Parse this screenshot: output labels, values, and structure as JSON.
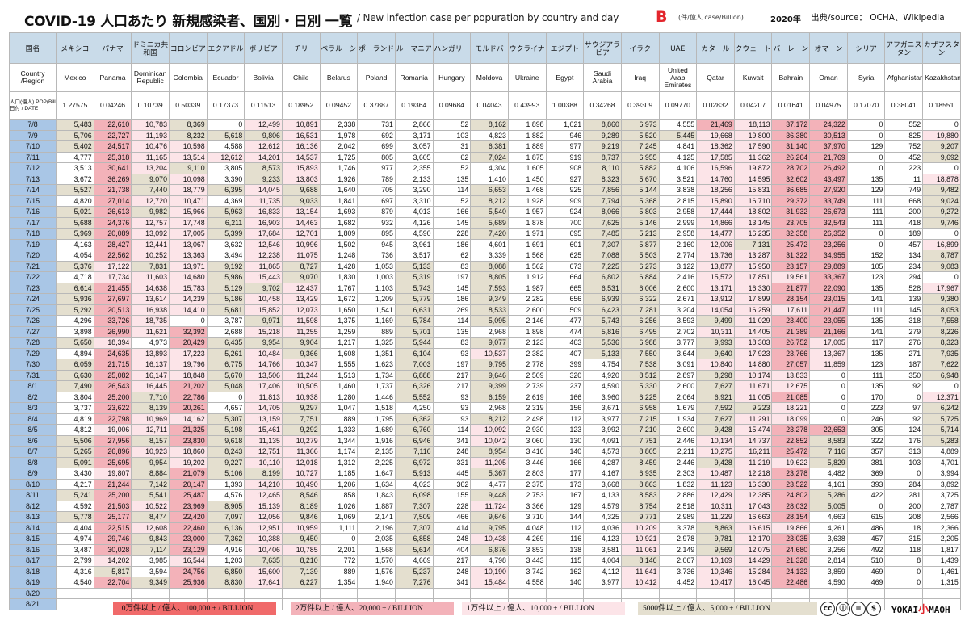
{
  "title": {
    "main": "COVID-19 人口あたり 新規感染者、国別・日別 一覧",
    "sub": "/ New infection case per popuration by country and day",
    "edition": "B",
    "unit": "(件/億人 case/Billion)",
    "year": "2020年",
    "source": "出典/source： OCHA、Wikipedia"
  },
  "headers": {
    "country_jp_label": "国名",
    "country_en_label": "Country /Region",
    "pop_label": "人口(億人) POP(Billion)",
    "date_label": "日付 / DATE",
    "jp": [
      "メキシコ",
      "パナマ",
      "ドミニカ共和国",
      "コロンビア",
      "エクアドル",
      "ボリビア",
      "チリ",
      "ベラルーシ",
      "ポーランド",
      "ルーマニア",
      "ハンガリー",
      "モルドバ",
      "ウクライナ",
      "エジプト",
      "サウジアラビア",
      "イラク",
      "UAE",
      "カタール",
      "クウェート",
      "バーレーン",
      "オマーン",
      "シリア",
      "アフガニスタン",
      "カザフスタン"
    ],
    "en": [
      "Mexico",
      "Panama",
      "Dominican Republic",
      "Colombia",
      "Ecuador",
      "Bolivia",
      "Chile",
      "Belarus",
      "Poland",
      "Romania",
      "Hungary",
      "Moldova",
      "Ukraine",
      "Egypt",
      "Saudi Arabia",
      "Iraq",
      "United Arab Emirates",
      "Qatar",
      "Kuwait",
      "Bahrain",
      "Oman",
      "Syria",
      "Afghanistan",
      "Kazakhstan"
    ],
    "pop": [
      "1.27575",
      "0.04246",
      "0.10739",
      "0.50339",
      "0.17373",
      "0.11513",
      "0.18952",
      "0.09452",
      "0.37887",
      "0.19364",
      "0.09684",
      "0.04043",
      "0.43993",
      "1.00388",
      "0.34268",
      "0.39309",
      "0.09770",
      "0.02832",
      "0.04207",
      "0.01641",
      "0.04975",
      "0.17070",
      "0.38041",
      "0.18551"
    ]
  },
  "rows": [
    [
      "7/8",
      "5,483",
      "22,610",
      "10,783",
      "8,369",
      "0",
      "12,499",
      "10,891",
      "2,338",
      "731",
      "2,866",
      "52",
      "8,162",
      "1,898",
      "1,021",
      "8,860",
      "6,973",
      "4,555",
      "21,469",
      "18,113",
      "37,172",
      "24,322",
      "0",
      "552",
      "0"
    ],
    [
      "7/9",
      "5,706",
      "22,727",
      "11,193",
      "8,232",
      "5,618",
      "9,806",
      "16,531",
      "1,978",
      "692",
      "3,171",
      "103",
      "4,823",
      "1,882",
      "946",
      "9,289",
      "5,520",
      "5,445",
      "19,668",
      "19,800",
      "36,380",
      "30,513",
      "0",
      "825",
      "19,880"
    ],
    [
      "7/10",
      "5,402",
      "24,517",
      "10,476",
      "10,598",
      "4,588",
      "12,612",
      "16,136",
      "2,042",
      "699",
      "3,057",
      "31",
      "6,381",
      "1,889",
      "977",
      "9,219",
      "7,245",
      "4,841",
      "18,362",
      "17,590",
      "31,140",
      "37,970",
      "129",
      "752",
      "9,207"
    ],
    [
      "7/11",
      "4,777",
      "25,318",
      "11,165",
      "13,514",
      "12,612",
      "14,201",
      "14,537",
      "1,725",
      "805",
      "3,605",
      "62",
      "7,024",
      "1,875",
      "919",
      "8,737",
      "6,955",
      "4,125",
      "17,585",
      "11,362",
      "26,264",
      "21,769",
      "0",
      "452",
      "9,692"
    ],
    [
      "7/12",
      "3,513",
      "30,641",
      "13,204",
      "9,110",
      "3,805",
      "8,573",
      "15,893",
      "1,746",
      "977",
      "2,355",
      "52",
      "4,304",
      "1,605",
      "908",
      "8,110",
      "5,882",
      "4,106",
      "16,596",
      "19,872",
      "28,702",
      "26,492",
      "0",
      "223",
      "0"
    ],
    [
      "7/13",
      "3,672",
      "36,269",
      "9,070",
      "10,098",
      "3,390",
      "9,233",
      "13,803",
      "1,926",
      "789",
      "2,133",
      "135",
      "1,410",
      "1,450",
      "927",
      "8,323",
      "5,670",
      "3,521",
      "14,760",
      "14,595",
      "32,602",
      "43,497",
      "135",
      "11",
      "18,878"
    ],
    [
      "7/14",
      "5,527",
      "21,738",
      "7,440",
      "18,779",
      "6,395",
      "14,045",
      "9,688",
      "1,640",
      "705",
      "3,290",
      "114",
      "6,653",
      "1,468",
      "925",
      "7,856",
      "5,144",
      "3,838",
      "18,256",
      "15,831",
      "36,685",
      "27,920",
      "129",
      "749",
      "9,482"
    ],
    [
      "7/15",
      "4,820",
      "27,014",
      "12,720",
      "10,471",
      "4,369",
      "11,735",
      "9,033",
      "1,841",
      "697",
      "3,310",
      "52",
      "8,212",
      "1,928",
      "909",
      "7,794",
      "5,368",
      "2,815",
      "15,890",
      "16,710",
      "29,372",
      "33,749",
      "111",
      "668",
      "9,024"
    ],
    [
      "7/16",
      "5,021",
      "26,613",
      "9,982",
      "15,966",
      "5,963",
      "16,833",
      "13,154",
      "1,693",
      "879",
      "4,013",
      "166",
      "5,540",
      "1,957",
      "924",
      "8,066",
      "5,803",
      "2,958",
      "17,444",
      "18,802",
      "31,932",
      "26,673",
      "111",
      "200",
      "9,272"
    ],
    [
      "7/17",
      "5,688",
      "24,376",
      "12,757",
      "17,748",
      "6,211",
      "16,903",
      "14,463",
      "1,682",
      "932",
      "4,126",
      "145",
      "5,689",
      "1,878",
      "700",
      "7,625",
      "5,146",
      "2,999",
      "14,866",
      "13,145",
      "23,705",
      "32,543",
      "111",
      "418",
      "9,746"
    ],
    [
      "7/18",
      "5,969",
      "20,089",
      "13,092",
      "17,005",
      "5,399",
      "17,684",
      "12,701",
      "1,809",
      "895",
      "4,590",
      "228",
      "7,420",
      "1,971",
      "695",
      "7,485",
      "5,213",
      "2,958",
      "14,477",
      "16,235",
      "32,358",
      "26,352",
      "0",
      "189",
      "0"
    ],
    [
      "7/19",
      "4,163",
      "28,427",
      "12,441",
      "13,067",
      "3,632",
      "12,546",
      "10,996",
      "1,502",
      "945",
      "3,961",
      "186",
      "4,601",
      "1,691",
      "601",
      "7,307",
      "5,877",
      "2,160",
      "12,006",
      "7,131",
      "25,472",
      "23,256",
      "0",
      "457",
      "16,899"
    ],
    [
      "7/20",
      "4,054",
      "22,562",
      "10,252",
      "13,363",
      "3,494",
      "12,238",
      "11,075",
      "1,248",
      "736",
      "3,517",
      "62",
      "3,339",
      "1,568",
      "625",
      "7,088",
      "5,503",
      "2,774",
      "13,736",
      "13,287",
      "31,322",
      "34,955",
      "152",
      "134",
      "8,787"
    ],
    [
      "7/21",
      "5,376",
      "17,122",
      "7,831",
      "13,971",
      "9,192",
      "11,865",
      "8,727",
      "1,428",
      "1,053",
      "5,133",
      "83",
      "8,088",
      "1,562",
      "673",
      "7,225",
      "6,273",
      "3,122",
      "13,877",
      "15,950",
      "23,157",
      "29,889",
      "105",
      "234",
      "9,083"
    ],
    [
      "7/22",
      "4,718",
      "17,734",
      "11,603",
      "14,680",
      "5,986",
      "15,443",
      "9,070",
      "1,830",
      "1,003",
      "5,319",
      "197",
      "8,805",
      "1,912",
      "664",
      "6,802",
      "6,884",
      "2,416",
      "15,572",
      "17,851",
      "19,561",
      "33,367",
      "123",
      "294",
      "0"
    ],
    [
      "7/23",
      "6,614",
      "21,455",
      "14,638",
      "15,783",
      "5,129",
      "9,702",
      "12,437",
      "1,767",
      "1,103",
      "5,743",
      "145",
      "7,593",
      "1,987",
      "665",
      "6,531",
      "6,006",
      "2,600",
      "13,171",
      "16,330",
      "21,877",
      "22,090",
      "135",
      "528",
      "17,967"
    ],
    [
      "7/24",
      "5,936",
      "27,697",
      "13,614",
      "14,239",
      "5,186",
      "10,458",
      "13,429",
      "1,672",
      "1,209",
      "5,779",
      "186",
      "9,349",
      "2,282",
      "656",
      "6,939",
      "6,322",
      "2,671",
      "13,912",
      "17,899",
      "28,154",
      "23,015",
      "141",
      "139",
      "9,380"
    ],
    [
      "7/25",
      "5,292",
      "20,513",
      "16,938",
      "14,410",
      "5,681",
      "15,852",
      "12,073",
      "1,650",
      "1,541",
      "6,631",
      "269",
      "8,533",
      "2,600",
      "509",
      "6,423",
      "7,281",
      "3,204",
      "14,054",
      "16,259",
      "17,611",
      "21,447",
      "111",
      "145",
      "8,053"
    ],
    [
      "7/26",
      "4,296",
      "33,726",
      "18,735",
      "0",
      "3,787",
      "9,971",
      "11,598",
      "1,375",
      "1,169",
      "5,784",
      "114",
      "5,095",
      "2,146",
      "477",
      "5,743",
      "6,256",
      "3,593",
      "9,499",
      "11,029",
      "23,400",
      "23,055",
      "135",
      "318",
      "7,558"
    ],
    [
      "7/27",
      "3,898",
      "26,990",
      "11,621",
      "32,392",
      "2,688",
      "15,218",
      "11,255",
      "1,259",
      "889",
      "5,701",
      "135",
      "2,968",
      "1,898",
      "474",
      "5,816",
      "6,495",
      "2,702",
      "10,311",
      "14,405",
      "21,389",
      "21,166",
      "141",
      "279",
      "8,226"
    ],
    [
      "7/28",
      "5,650",
      "18,394",
      "4,973",
      "20,429",
      "6,435",
      "9,954",
      "9,904",
      "1,217",
      "1,325",
      "5,944",
      "83",
      "9,077",
      "2,123",
      "463",
      "5,536",
      "6,988",
      "3,777",
      "9,993",
      "18,303",
      "26,752",
      "17,005",
      "117",
      "276",
      "8,323"
    ],
    [
      "7/29",
      "4,894",
      "24,635",
      "13,893",
      "17,223",
      "5,261",
      "10,484",
      "9,366",
      "1,608",
      "1,351",
      "6,104",
      "93",
      "10,537",
      "2,382",
      "407",
      "5,133",
      "7,550",
      "3,644",
      "9,640",
      "17,923",
      "23,766",
      "13,367",
      "135",
      "271",
      "7,935"
    ],
    [
      "7/30",
      "6,059",
      "21,715",
      "16,137",
      "19,796",
      "6,775",
      "14,766",
      "10,347",
      "1,555",
      "1,623",
      "7,003",
      "197",
      "9,795",
      "2,778",
      "399",
      "4,754",
      "7,538",
      "3,091",
      "10,840",
      "14,880",
      "27,057",
      "11,859",
      "123",
      "187",
      "7,622"
    ],
    [
      "7/31",
      "6,630",
      "25,082",
      "16,147",
      "18,848",
      "5,670",
      "13,506",
      "11,244",
      "1,513",
      "1,734",
      "6,888",
      "217",
      "9,646",
      "2,509",
      "320",
      "4,920",
      "8,512",
      "2,897",
      "8,298",
      "10,174",
      "13,833",
      "0",
      "111",
      "350",
      "6,948"
    ],
    [
      "8/1",
      "7,490",
      "26,543",
      "16,445",
      "21,202",
      "5,048",
      "17,406",
      "10,505",
      "1,460",
      "1,737",
      "6,326",
      "217",
      "9,399",
      "2,739",
      "237",
      "4,590",
      "5,330",
      "2,600",
      "7,627",
      "11,671",
      "12,675",
      "0",
      "135",
      "92",
      "0"
    ],
    [
      "8/2",
      "3,804",
      "25,200",
      "7,710",
      "22,786",
      "0",
      "11,813",
      "10,938",
      "1,280",
      "1,446",
      "5,552",
      "93",
      "6,159",
      "2,619",
      "166",
      "3,960",
      "6,225",
      "2,064",
      "6,921",
      "11,005",
      "21,085",
      "0",
      "170",
      "0",
      "12,371"
    ],
    [
      "8/3",
      "3,737",
      "23,622",
      "8,139",
      "20,261",
      "4,657",
      "14,705",
      "9,297",
      "1,047",
      "1,518",
      "4,250",
      "93",
      "2,968",
      "2,319",
      "156",
      "3,671",
      "6,958",
      "1,679",
      "7,592",
      "9,223",
      "18,221",
      "0",
      "223",
      "97",
      "6,242"
    ],
    [
      "8/4",
      "4,819",
      "22,798",
      "10,969",
      "14,162",
      "5,307",
      "13,159",
      "7,751",
      "889",
      "1,795",
      "6,362",
      "93",
      "8,212",
      "2,498",
      "112",
      "3,977",
      "7,215",
      "1,934",
      "7,627",
      "11,291",
      "18,099",
      "0",
      "246",
      "92",
      "5,725"
    ],
    [
      "8/5",
      "4,812",
      "19,006",
      "12,711",
      "21,325",
      "5,198",
      "15,461",
      "9,292",
      "1,333",
      "1,689",
      "6,760",
      "114",
      "10,092",
      "2,930",
      "123",
      "3,992",
      "7,210",
      "2,600",
      "9,428",
      "15,474",
      "23,278",
      "22,653",
      "305",
      "124",
      "5,714"
    ],
    [
      "8/6",
      "5,506",
      "27,956",
      "8,157",
      "23,830",
      "9,618",
      "11,135",
      "10,279",
      "1,344",
      "1,916",
      "6,946",
      "341",
      "10,042",
      "3,060",
      "130",
      "4,091",
      "7,751",
      "2,446",
      "10,134",
      "14,737",
      "22,852",
      "8,583",
      "322",
      "176",
      "5,283"
    ],
    [
      "8/7",
      "5,265",
      "26,896",
      "10,923",
      "18,860",
      "8,243",
      "12,751",
      "11,366",
      "1,174",
      "2,135",
      "7,116",
      "248",
      "8,954",
      "3,416",
      "140",
      "4,573",
      "8,805",
      "2,211",
      "10,275",
      "16,211",
      "25,472",
      "7,116",
      "357",
      "313",
      "4,889"
    ],
    [
      "8/8",
      "5,091",
      "25,695",
      "9,954",
      "19,202",
      "9,227",
      "10,110",
      "12,018",
      "1,312",
      "2,225",
      "6,972",
      "331",
      "11,205",
      "3,446",
      "166",
      "4,287",
      "8,459",
      "2,446",
      "9,428",
      "11,219",
      "19,622",
      "5,829",
      "381",
      "103",
      "4,701"
    ],
    [
      "8/9",
      "3,430",
      "19,807",
      "8,884",
      "21,079",
      "5,106",
      "8,199",
      "10,727",
      "1,185",
      "1,647",
      "5,913",
      "445",
      "5,367",
      "2,803",
      "177",
      "4,167",
      "6,935",
      "2,303",
      "10,487",
      "12,218",
      "23,278",
      "4,482",
      "369",
      "0",
      "3,994"
    ],
    [
      "8/10",
      "4,217",
      "21,244",
      "7,142",
      "20,147",
      "1,393",
      "14,210",
      "10,490",
      "1,206",
      "1,634",
      "4,023",
      "362",
      "4,477",
      "2,375",
      "173",
      "3,668",
      "8,863",
      "1,832",
      "11,123",
      "16,330",
      "23,522",
      "4,161",
      "393",
      "284",
      "3,892"
    ],
    [
      "8/11",
      "5,241",
      "25,200",
      "5,541",
      "25,487",
      "4,576",
      "12,465",
      "8,546",
      "858",
      "1,843",
      "6,098",
      "155",
      "9,448",
      "2,753",
      "167",
      "4,133",
      "8,583",
      "2,886",
      "12,429",
      "12,385",
      "24,802",
      "5,286",
      "422",
      "281",
      "3,725"
    ],
    [
      "8/12",
      "4,592",
      "21,503",
      "10,522",
      "23,969",
      "8,905",
      "15,139",
      "8,189",
      "1,026",
      "1,887",
      "7,307",
      "228",
      "11,724",
      "3,366",
      "129",
      "4,579",
      "8,754",
      "2,518",
      "10,311",
      "17,043",
      "28,032",
      "5,005",
      "0",
      "200",
      "2,787"
    ],
    [
      "8/13",
      "5,778",
      "25,177",
      "8,474",
      "22,420",
      "7,097",
      "12,056",
      "9,846",
      "1,069",
      "2,141",
      "7,509",
      "466",
      "9,646",
      "3,710",
      "144",
      "4,325",
      "9,771",
      "2,989",
      "11,229",
      "16,663",
      "28,154",
      "4,663",
      "615",
      "208",
      "2,566"
    ],
    [
      "8/14",
      "4,404",
      "22,515",
      "12,608",
      "22,460",
      "6,136",
      "12,951",
      "10,959",
      "1,111",
      "2,196",
      "7,307",
      "414",
      "9,795",
      "4,048",
      "112",
      "4,036",
      "10,209",
      "3,378",
      "8,863",
      "16,615",
      "19,866",
      "4,261",
      "486",
      "18",
      "2,366"
    ],
    [
      "8/15",
      "4,974",
      "29,746",
      "9,843",
      "23,000",
      "7,362",
      "10,388",
      "9,450",
      "0",
      "2,035",
      "6,858",
      "248",
      "10,438",
      "4,269",
      "116",
      "4,123",
      "10,921",
      "2,978",
      "9,781",
      "12,170",
      "23,035",
      "3,638",
      "457",
      "315",
      "2,205"
    ],
    [
      "8/16",
      "3,487",
      "30,028",
      "7,114",
      "23,129",
      "4,916",
      "10,406",
      "10,785",
      "2,201",
      "1,568",
      "5,614",
      "404",
      "6,876",
      "3,853",
      "138",
      "3,581",
      "11,061",
      "2,149",
      "9,569",
      "12,075",
      "24,680",
      "3,256",
      "492",
      "118",
      "1,817"
    ],
    [
      "8/17",
      "2,799",
      "14,202",
      "3,985",
      "16,544",
      "1,203",
      "7,635",
      "8,210",
      "772",
      "1,570",
      "4,669",
      "217",
      "4,798",
      "3,443",
      "115",
      "4,004",
      "8,146",
      "2,067",
      "10,169",
      "14,429",
      "21,328",
      "2,814",
      "510",
      "8",
      "1,439"
    ],
    [
      "8/18",
      "4,316",
      "5,817",
      "3,594",
      "24,756",
      "6,850",
      "15,600",
      "7,139",
      "889",
      "1,576",
      "5,237",
      "248",
      "10,190",
      "3,742",
      "162",
      "4,112",
      "11,641",
      "3,736",
      "10,346",
      "15,284",
      "24,132",
      "3,859",
      "469",
      "0",
      "1,461"
    ],
    [
      "8/19",
      "4,540",
      "22,704",
      "9,349",
      "25,936",
      "8,830",
      "17,641",
      "6,227",
      "1,354",
      "1,940",
      "7,276",
      "341",
      "15,484",
      "4,558",
      "140",
      "3,977",
      "10,412",
      "4,452",
      "10,417",
      "16,045",
      "22,486",
      "4,590",
      "469",
      "0",
      "1,315"
    ],
    [
      "8/20"
    ],
    [
      "8/21"
    ]
  ],
  "legend": [
    "10万件以上 / 億人、100,000 + / BILLION",
    "2万件以上 / 億人、20,000 + / BILLION",
    "1万件以上 / 億人、10,000 + / BILLION",
    "5000件以上 / 億人、5,000 + / BILLION"
  ],
  "license_icons": [
    "cc",
    "by",
    "nd",
    "nc"
  ],
  "logo": {
    "pre": "YOKAI",
    "mid": "小",
    "post": "MAOH"
  },
  "colors": {
    "l100": "#f06a6a",
    "l20": "#f3b2b9",
    "l10": "#fce4e8",
    "l5": "#e4dfcf",
    "date_col": "#a9c6e6",
    "header": "#c9dbe9",
    "accent": "#e3262d"
  }
}
